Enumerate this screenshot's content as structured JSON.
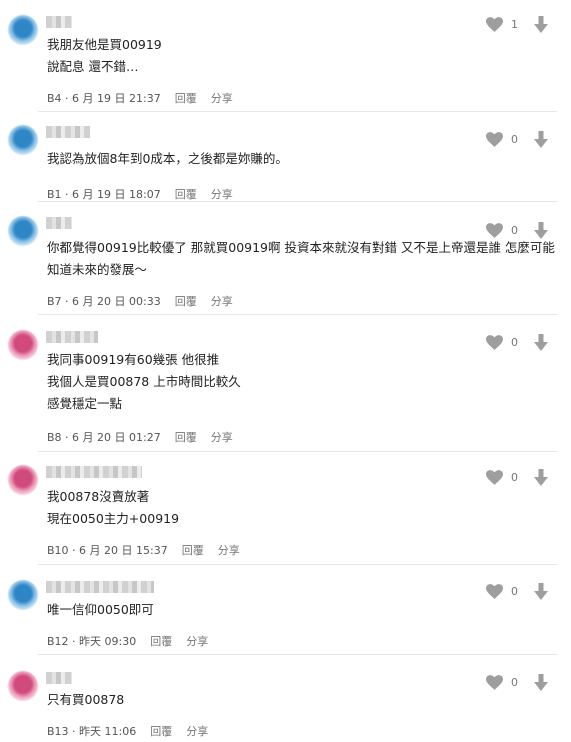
{
  "comments": [
    {
      "floor": "B4",
      "date": "6 月 19 日 21:37",
      "likes": "1",
      "lines": [
        "我朋友他是買00919",
        "說配息 還不錯…"
      ],
      "avatar": "blue"
    },
    {
      "floor": "B1",
      "date": "6 月 19 日 18:07",
      "likes": "0",
      "lines": [
        "我認為放個8年到0成本，之後都是妳賺的。"
      ],
      "avatar": "blue"
    },
    {
      "floor": "B7",
      "date": "6 月 20 日 00:33",
      "likes": "0",
      "lines": [
        "你都覺得00919比較優了 那就買00919啊 投資本來就沒有對錯 又不是上帝還是誰 怎麼可能",
        "知道未來的發展～"
      ],
      "avatar": "blue"
    },
    {
      "floor": "B8",
      "date": "6 月 20 日 01:27",
      "likes": "0",
      "lines": [
        "我同事00919有60幾張 他很推",
        "我個人是買00878 上市時間比較久",
        "感覺穩定一點"
      ],
      "avatar": "pink"
    },
    {
      "floor": "B10",
      "date": "6 月 20 日 15:37",
      "likes": "0",
      "lines": [
        "我00878沒賣放著",
        "現在0050主力+00919"
      ],
      "avatar": "pink"
    },
    {
      "floor": "B12",
      "date": "昨天 09:30",
      "likes": "0",
      "lines": [
        "唯一信仰0050即可"
      ],
      "avatar": "blue"
    },
    {
      "floor": "B13",
      "date": "昨天 11:06",
      "likes": "0",
      "lines": [
        "只有買00878"
      ],
      "avatar": "pink"
    }
  ],
  "labels": {
    "reply": "回覆",
    "share": "分享",
    "separator": " · "
  },
  "colors": {
    "icon": "#9e9e9e",
    "text": "#222222",
    "meta": "#555555"
  }
}
